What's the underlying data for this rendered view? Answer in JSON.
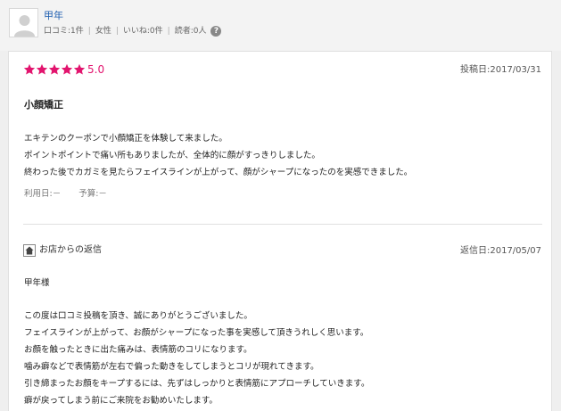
{
  "user": {
    "name": "甲年",
    "reviews": "口コミ:1件",
    "gender": "女性",
    "likes": "いいね:0件",
    "readers": "読者:0人",
    "help": "?"
  },
  "review": {
    "rating_value": 5,
    "rating_text": "5.0",
    "post_date": "投稿日:2017/03/31",
    "title": "小顔矯正",
    "body": [
      "エキテンのクーポンで小顔矯正を体験して来ました。",
      "ポイントポイントで痛い所もありましたが、全体的に顔がすっきりしました。",
      "終わった後でカガミを見たらフェイスラインが上がって、顔がシャープになったのを実感できました。"
    ],
    "usage_date": "利用日:－",
    "budget": "予算:－"
  },
  "reply": {
    "label": "お店からの返信",
    "date": "返信日:2017/05/07",
    "salutation": "甲年様",
    "body": [
      "この度は口コミ投稿を頂き、誠にありがとうございました。",
      "フェイスラインが上がって、お顔がシャープになった事を実感して頂きうれしく思います。",
      "お顔を触ったときに出た痛みは、表情筋のコリになります。",
      "噛み癖などで表情筋が左右で偏った動きをしてしまうとコリが現れてきます。",
      "引き締まったお顔をキープするには、先ずはしっかりと表情筋にアプローチしていきます。",
      "癖が戻ってしまう前にご来院をお勧めいたします。"
    ]
  },
  "colors": {
    "star": "#e2146e",
    "link": "#1f5fb0"
  },
  "icons": {
    "avatar": "person-silhouette-icon",
    "help": "question-circle-icon",
    "star": "star-icon",
    "shop": "home-icon"
  }
}
